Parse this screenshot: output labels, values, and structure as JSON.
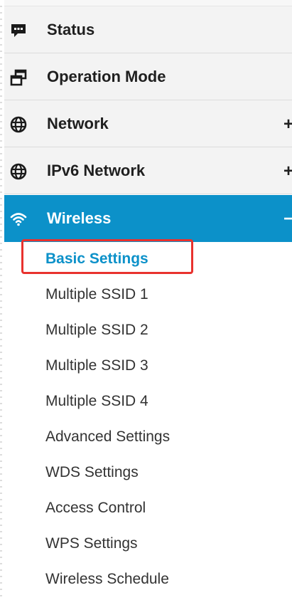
{
  "menu": {
    "items": [
      {
        "label": "Status",
        "icon": "chat-bubble-icon"
      },
      {
        "label": "Operation Mode",
        "icon": "window-swap-icon"
      },
      {
        "label": "Network",
        "icon": "globe-icon",
        "expander": "+"
      },
      {
        "label": "IPv6 Network",
        "icon": "globe-icon",
        "expander": "+"
      },
      {
        "label": "Wireless",
        "icon": "wifi-icon",
        "expander": "−",
        "active": true
      }
    ],
    "wireless_submenu": [
      "Basic Settings",
      "Multiple SSID 1",
      "Multiple SSID 2",
      "Multiple SSID 3",
      "Multiple SSID 4",
      "Advanced Settings",
      "WDS Settings",
      "Access Control",
      "WPS Settings",
      "Wireless Schedule"
    ],
    "selected_submenu": "Basic Settings"
  },
  "colors": {
    "active_bg": "#0c91c9",
    "selected_text": "#0c91c9",
    "highlight_border": "#e8322e"
  }
}
